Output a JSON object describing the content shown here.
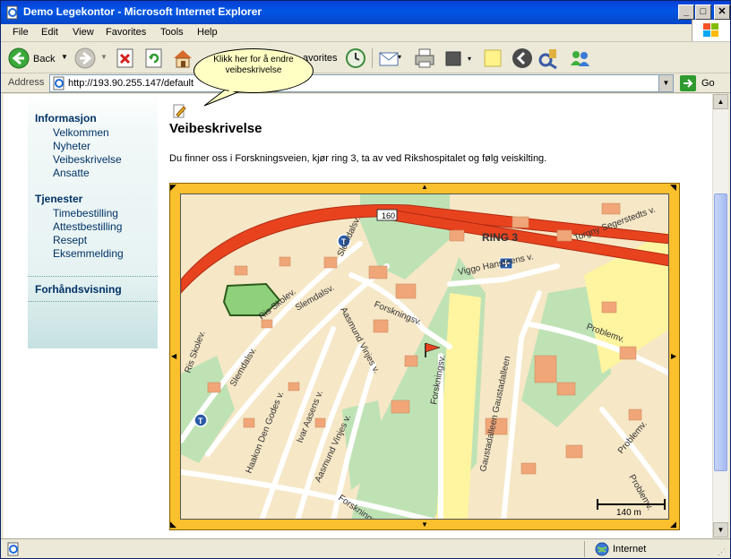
{
  "window": {
    "title": "Demo Legekontor - Microsoft Internet Explorer",
    "buttons": {
      "minimize": "_",
      "maximize": "□",
      "close": "✕"
    }
  },
  "menu": [
    "File",
    "Edit",
    "View",
    "Favorites",
    "Tools",
    "Help"
  ],
  "toolbar": {
    "back_label": "Back",
    "favorites_label": "avorites"
  },
  "address": {
    "label": "Address",
    "url": "http://193.90.255.147/default",
    "go_label": "Go"
  },
  "tooltip": {
    "text": "Klikk her for å endre veibeskrivelse"
  },
  "sidebar": {
    "sections": [
      {
        "heading": "Informasjon",
        "items": [
          "Velkommen",
          "Nyheter",
          "Veibeskrivelse",
          "Ansatte"
        ]
      },
      {
        "heading": "Tjenester",
        "items": [
          "Timebestilling",
          "Attestbestilling",
          "Resept",
          "Eksemmelding"
        ]
      },
      {
        "heading": "Forhåndsvisning",
        "items": []
      }
    ]
  },
  "main": {
    "title": "Veibeskrivelse",
    "text": "Du finner oss i Forskningsveien, kjør ring 3, ta av ved Rikshospitalet og følg veiskilting."
  },
  "map": {
    "labels": {
      "ring3": "RING 3",
      "viggo": "Viggo Hansteens v.",
      "torgny": "Torgny Segerstedts v.",
      "slemdalsv1": "Slemdalsv.",
      "slemdalsv2": "Slemdalsv.",
      "slemdalsv3": "Slemdalsv.",
      "risskolev1": "Ris Skolev.",
      "risskolev2": "Ris Skolev.",
      "forskningsv1": "Forskningsv.",
      "forskningsv2": "Forskningsv.",
      "forskningsv3": "Forskningsv.",
      "aasmund1": "Aasmund Vinjes v.",
      "aasmund2": "Aasmund Vinjes v.",
      "haakon": "Haakon Den Godes v.",
      "ivar": "Ivar Aasens v.",
      "gaustad": "Gaustadalleen Gaustadalleen",
      "problemv1": "Problemv.",
      "problemv2": "Problemv.",
      "problemv3": "Problemv.",
      "road160": "160",
      "scale": "140 m"
    }
  },
  "status": {
    "zone": "Internet"
  },
  "colors": {
    "nav_text": "#003366",
    "map_border": "#fbc02d",
    "ring_road": "#e8431f"
  }
}
